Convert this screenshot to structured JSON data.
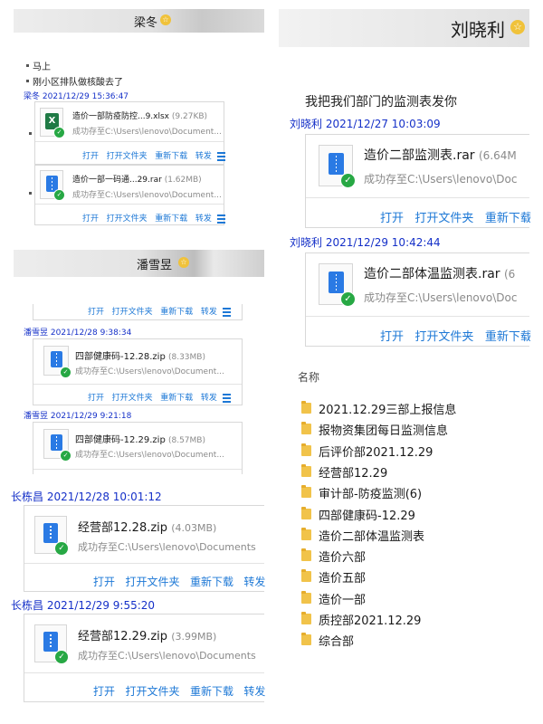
{
  "panel_a": {
    "contact": "梁冬",
    "messages": [
      "马上",
      "刚小区排队做核酸去了"
    ],
    "timestamp": "梁冬 2021/12/29 15:36:47",
    "files": [
      {
        "name": "造价一部防疫防控...9.xlsx",
        "size": "(9.27KB)",
        "status": "成功存至C:\\Users\\lenovo\\Document...",
        "type": "xlsx"
      },
      {
        "name": "造价一部一码通...29.rar",
        "size": "(1.62MB)",
        "status": "成功存至C:\\Users\\lenovo\\Document...",
        "type": "zip"
      }
    ]
  },
  "panel_b": {
    "contact": "潘雪昱",
    "top_actions_partial": true,
    "entries": [
      {
        "timestamp": "潘雪昱 2021/12/28 9:38:34",
        "name": "四部健康码-12.28.zip",
        "size": "(8.33MB)",
        "status": "成功存至C:\\Users\\lenovo\\Document..."
      },
      {
        "timestamp": "潘雪昱 2021/12/29 9:21:18",
        "name": "四部健康码-12.29.zip",
        "size": "(8.57MB)",
        "status": "成功存至C:\\Users\\lenovo\\Document..."
      }
    ]
  },
  "panel_c": {
    "entries": [
      {
        "timestamp": "长栋昌 2021/12/28 10:01:12",
        "name": "经营部12.28.zip",
        "size": "(4.03MB)",
        "status": "成功存至C:\\Users\\lenovo\\Documents"
      },
      {
        "timestamp": "长栋昌 2021/12/29 9:55:20",
        "name": "经营部12.29.zip",
        "size": "(3.99MB)",
        "status": "成功存至C:\\Users\\lenovo\\Documents"
      }
    ]
  },
  "panel_d": {
    "contact": "刘晓利",
    "message": "我把我们部门的监测表发你",
    "entries": [
      {
        "timestamp": "刘晓利 2021/12/27 10:03:09",
        "name": "造价二部监测表.rar",
        "size": "(6.64M",
        "status": "成功存至C:\\Users\\lenovo\\Doc"
      },
      {
        "timestamp": "刘晓利 2021/12/29 10:42:44",
        "name": "造价二部体温监测表.rar",
        "size": "(6",
        "status": "成功存至C:\\Users\\lenovo\\Doc"
      }
    ]
  },
  "actions": {
    "open": "打开",
    "open_folder": "打开文件夹",
    "redownload": "重新下载",
    "forward": "转发"
  },
  "actions_d": {
    "open": "打开",
    "open_folder": "打开文件夹",
    "redownload": "重新下载"
  },
  "actions_c": {
    "open": "打开",
    "open_folder": "打开文件夹",
    "redownload": "重新下载",
    "forward": "转发"
  },
  "folder_list": {
    "header": "名称",
    "items": [
      "2021.12.29三部上报信息",
      "报物资集团每日监测信息",
      "后评价部2021.12.29",
      "经营部12.29",
      "审计部-防疫监测(6)",
      "四部健康码-12.29",
      "造价二部体温监测表",
      "造价六部",
      "造价五部",
      "造价一部",
      "质控部2021.12.29",
      "综合部"
    ]
  },
  "colors": {
    "link": "#1d78d6",
    "timestamp": "#1530c8",
    "success": "#27a844",
    "folder": "#f1c34a"
  }
}
